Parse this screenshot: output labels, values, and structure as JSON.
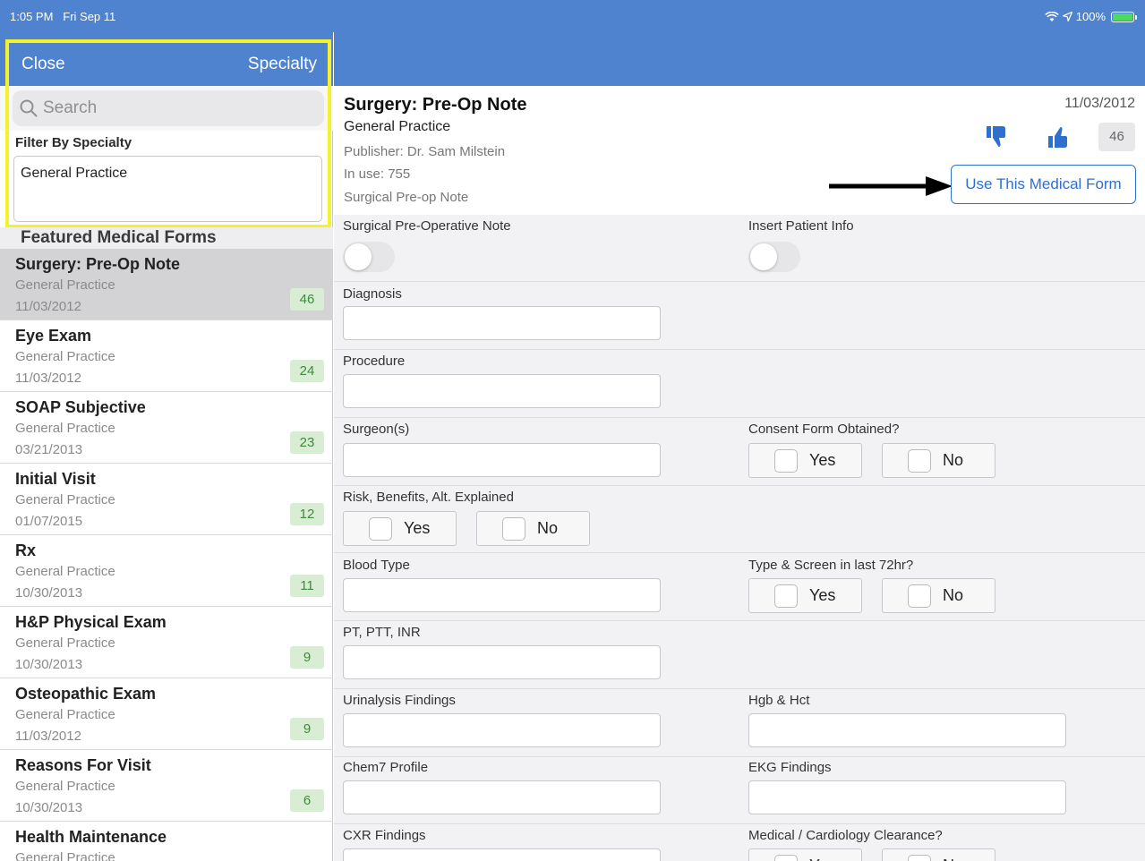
{
  "status_bar": {
    "time": "1:05 PM",
    "date": "Fri Sep 11",
    "battery": "100%"
  },
  "sidebar": {
    "close_label": "Close",
    "specialty_label": "Specialty",
    "search_placeholder": "Search",
    "filter_label": "Filter By Specialty",
    "filter_value": "General Practice",
    "featured_header": "Featured Medical Forms",
    "items": [
      {
        "title": "Surgery: Pre-Op Note",
        "specialty": "General Practice",
        "date": "11/03/2012",
        "count": "46"
      },
      {
        "title": "Eye Exam",
        "specialty": "General Practice",
        "date": "11/03/2012",
        "count": "24"
      },
      {
        "title": "SOAP Subjective",
        "specialty": "General Practice",
        "date": "03/21/2013",
        "count": "23"
      },
      {
        "title": "Initial Visit",
        "specialty": "General Practice",
        "date": "01/07/2015",
        "count": "12"
      },
      {
        "title": "Rx",
        "specialty": "General Practice",
        "date": "10/30/2013",
        "count": "11"
      },
      {
        "title": "H&P Physical Exam",
        "specialty": "General Practice",
        "date": "10/30/2013",
        "count": "9"
      },
      {
        "title": "Osteopathic Exam",
        "specialty": "General Practice",
        "date": "11/03/2012",
        "count": "9"
      },
      {
        "title": "Reasons For Visit",
        "specialty": "General Practice",
        "date": "10/30/2013",
        "count": "6"
      },
      {
        "title": "Health Maintenance",
        "specialty": "General Practice",
        "date": "",
        "count": ""
      }
    ]
  },
  "detail": {
    "title": "Surgery: Pre-Op Note",
    "specialty": "General Practice",
    "publisher": "Publisher: Dr. Sam Milstein",
    "in_use": "In use: 755",
    "subtitle": "Surgical Pre-op Note",
    "date": "11/03/2012",
    "rating_count": "46",
    "use_button": "Use This Medical Form"
  },
  "form": {
    "surgical_note": "Surgical Pre-Operative Note",
    "insert_patient": "Insert Patient Info",
    "diagnosis": "Diagnosis",
    "procedure": "Procedure",
    "surgeons": "Surgeon(s)",
    "consent": "Consent Form Obtained?",
    "risk": "Risk, Benefits, Alt. Explained",
    "blood_type": "Blood Type",
    "type_screen": "Type & Screen in last 72hr?",
    "pt_ptt": "PT, PTT, INR",
    "urinalysis": "Urinalysis Findings",
    "hgb": "Hgb & Hct",
    "chem7": "Chem7 Profile",
    "ekg": "EKG Findings",
    "cxr": "CXR Findings",
    "clearance": "Medical / Cardiology Clearance?",
    "yes": "Yes",
    "no": "No"
  },
  "colors": {
    "nav_blue": "#4f83cf",
    "highlight": "#f5f22c",
    "badge_bg": "#d8edd3",
    "link_blue": "#2f6fce"
  },
  "icons": [
    "search-icon",
    "wifi-icon",
    "location-icon",
    "battery-icon",
    "thumbs-down-icon",
    "thumbs-up-icon",
    "arrow-right-icon"
  ]
}
